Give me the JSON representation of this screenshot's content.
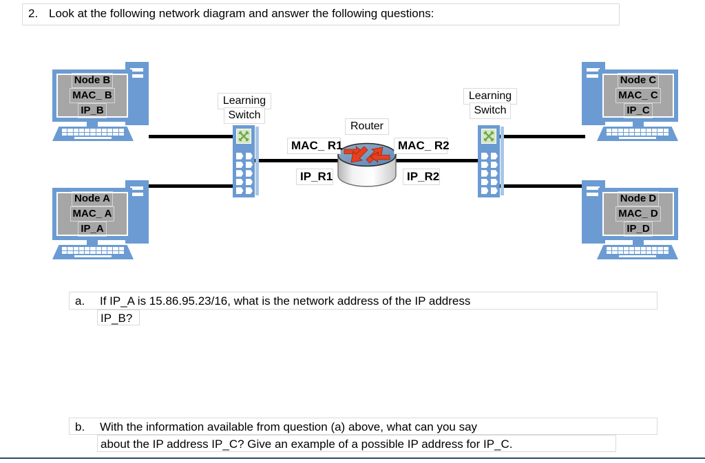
{
  "question": {
    "number": "2.",
    "prompt": "Look at the following network diagram and answer the following questions:",
    "parts": [
      {
        "letter": "a.",
        "line1": "If IP_A is 15.86.95.23/16, what is the network address of the IP address",
        "line2": "IP_B?"
      },
      {
        "letter": "b.",
        "line1": "With the information available from question (a) above, what can you say",
        "line2": "about the IP address IP_C? Give an example of a possible IP address for IP_C."
      }
    ]
  },
  "diagram": {
    "nodes": [
      {
        "id": "node-b",
        "name": "Node B",
        "mac": "MAC_ B",
        "ip": "IP_B"
      },
      {
        "id": "node-a",
        "name": "Node A",
        "mac": "MAC_ A",
        "ip": "IP_A"
      },
      {
        "id": "node-c",
        "name": "Node C",
        "mac": "MAC_ C",
        "ip": "IP_C"
      },
      {
        "id": "node-d",
        "name": "Node D",
        "mac": "MAC_ D",
        "ip": "IP_D"
      }
    ],
    "switches": [
      {
        "id": "switch-left",
        "line1": "Learning",
        "line2": "Switch"
      },
      {
        "id": "switch-right",
        "line1": "Learning",
        "line2": "Switch"
      }
    ],
    "router": {
      "title": "Router",
      "mac_left": "MAC_ R1",
      "ip_left": "IP_R1",
      "mac_right": "MAC_ R2",
      "ip_right": "IP_R2"
    },
    "colors": {
      "device_blue": "#6b9bd2",
      "screen_gray": "#a6a6a6",
      "switch_strip": "#a8c6e6",
      "switch_glyph_bg": "#d6e7c5",
      "router_arrow_red": "#e8401f",
      "router_top_blue": "#6f97c4",
      "wire_black": "#000000",
      "divider": "#2e4a62",
      "box_border": "#d9d9d9"
    }
  }
}
